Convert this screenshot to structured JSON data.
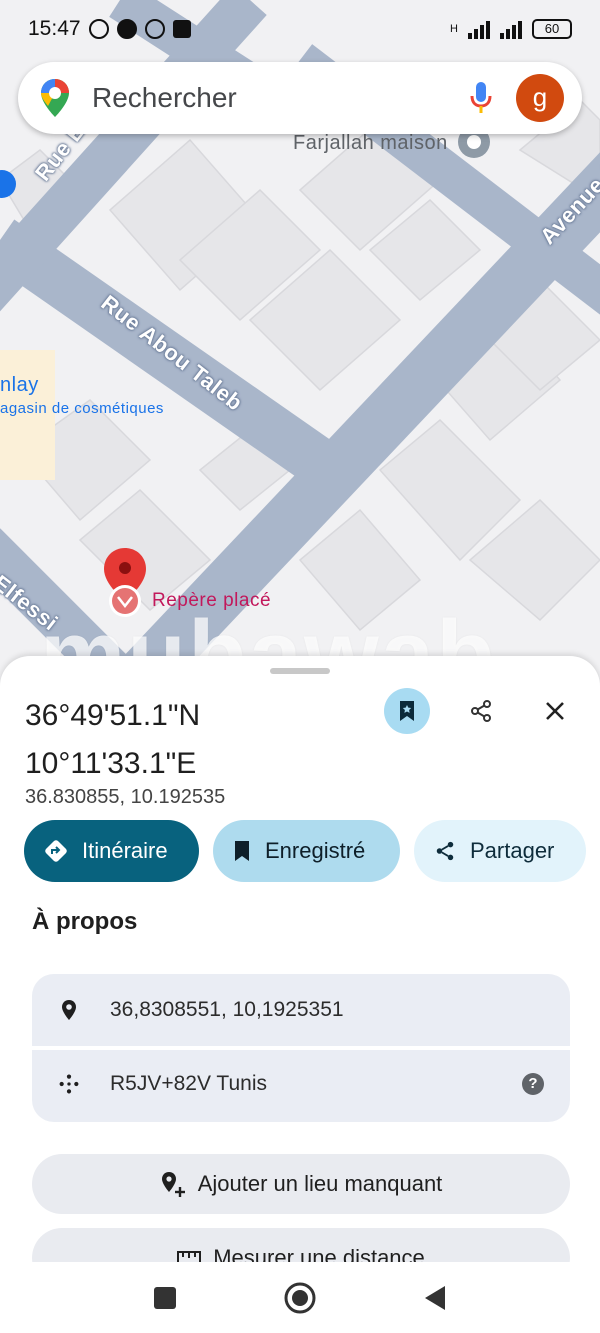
{
  "status_bar": {
    "time": "15:47",
    "network": "H",
    "battery": "60"
  },
  "search": {
    "placeholder": "Rechercher",
    "avatar_letter": "g"
  },
  "map": {
    "labels": {
      "place_top": "Farjallah maison",
      "street_1": "Rue El Be",
      "street_2": "Rue Abou Taleb",
      "street_3": "Avenue A",
      "street_4": "Elfessi",
      "shop_name": "nlay",
      "shop_type": "agasin de cosmétiques",
      "marker_label": "Repère placé"
    }
  },
  "watermark": "mubawab",
  "sheet": {
    "title_lat": "36°49'51.1\"N",
    "title_lon": "10°11'33.1\"E",
    "decimal": "36.830855, 10.192535",
    "chips": {
      "directions": "Itinéraire",
      "saved": "Enregistré",
      "share": "Partager"
    },
    "about_title": "À propos",
    "info": {
      "coords": "36,8308551, 10,1925351",
      "plus_code": "R5JV+82V Tunis"
    },
    "actions": {
      "add_place": "Ajouter un lieu manquant",
      "measure": "Mesurer une distance"
    }
  },
  "colors": {
    "primary_chip": "#08627e",
    "saved_chip": "#aedbee",
    "share_chip": "#e2f3fb",
    "marker": "#e53935",
    "avatar": "#d14a0f"
  }
}
